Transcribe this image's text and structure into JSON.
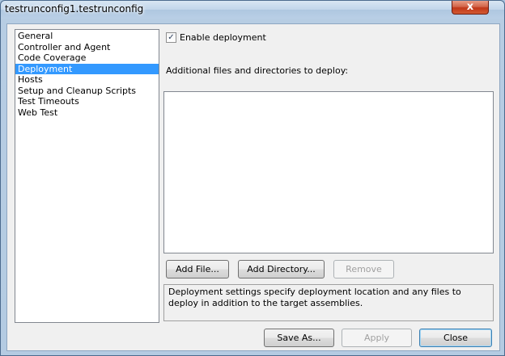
{
  "window": {
    "title": "testrunconfig1.testrunconfig",
    "close_glyph": "x"
  },
  "categories": [
    {
      "label": "General",
      "selected": false
    },
    {
      "label": "Controller and Agent",
      "selected": false
    },
    {
      "label": "Code Coverage",
      "selected": false
    },
    {
      "label": "Deployment",
      "selected": true
    },
    {
      "label": "Hosts",
      "selected": false
    },
    {
      "label": "Setup and Cleanup Scripts",
      "selected": false
    },
    {
      "label": "Test Timeouts",
      "selected": false
    },
    {
      "label": "Web Test",
      "selected": false
    }
  ],
  "deployment": {
    "enable_label": "Enable deployment",
    "enable_checked": true,
    "check_glyph": "✓",
    "files_label": "Additional files and directories to deploy:",
    "files": [],
    "add_file_label": "Add File...",
    "add_directory_label": "Add Directory...",
    "remove_label": "Remove",
    "description": "Deployment settings specify deployment location and any files to deploy in addition to the target assemblies."
  },
  "footer": {
    "save_as_label": "Save As...",
    "apply_label": "Apply",
    "close_label": "Close"
  },
  "colors": {
    "selection": "#3399ff",
    "client_bg": "#f0f0f0",
    "frame": "#b4cbe2",
    "close_button": "#c13718"
  }
}
